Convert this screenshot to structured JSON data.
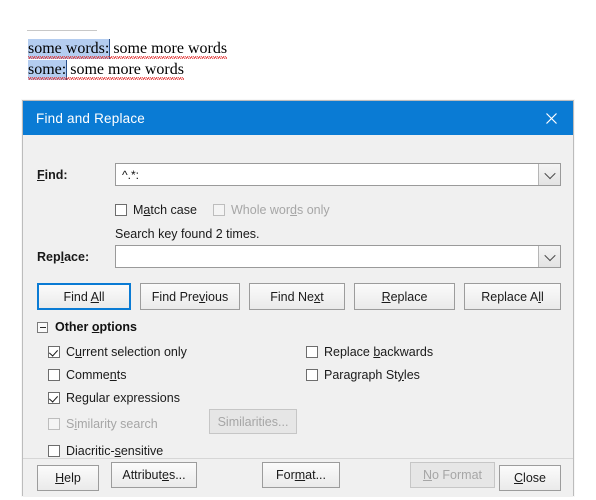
{
  "document": {
    "lines": [
      {
        "selected_text": "some words:",
        "rest_text": " some more words"
      },
      {
        "selected_text": "some:",
        "rest_text": " some more words"
      }
    ]
  },
  "dialog": {
    "title": "Find and Replace",
    "close_icon": "close-icon",
    "find": {
      "label": "Find:",
      "value": "^.*:",
      "placeholder": "",
      "dropdown_icon": "chevron-down-icon"
    },
    "replace": {
      "label": "Replace:",
      "value": "",
      "placeholder": "",
      "dropdown_icon": "chevron-down-icon"
    },
    "find_options": [
      {
        "label": "Match case",
        "mnemonic": "a",
        "checked": false,
        "disabled": false
      },
      {
        "label": "Whole words only",
        "mnemonic": "d",
        "checked": false,
        "disabled": true
      }
    ],
    "status": "Search key found 2 times.",
    "action_buttons": [
      {
        "label": "Find All",
        "mnemonic": "A",
        "focused": true,
        "disabled": false
      },
      {
        "label": "Find Previous",
        "mnemonic": "v",
        "focused": false,
        "disabled": false
      },
      {
        "label": "Find Next",
        "mnemonic": "x",
        "focused": false,
        "disabled": false
      },
      {
        "label": "Replace",
        "mnemonic": "R",
        "focused": false,
        "disabled": false
      },
      {
        "label": "Replace All",
        "mnemonic": "l",
        "focused": false,
        "disabled": false
      }
    ],
    "other_options": {
      "label": "Other options",
      "mnemonic": "o",
      "expanded": true,
      "left_column": [
        {
          "label": "Current selection only",
          "mnemonic": "u",
          "checked": true,
          "disabled": false
        },
        {
          "label": "Comments",
          "mnemonic": "n",
          "checked": false,
          "disabled": false
        },
        {
          "label": "Regular expressions",
          "mnemonic": "g",
          "checked": true,
          "disabled": false
        }
      ],
      "right_column": [
        {
          "label": "Replace backwards",
          "mnemonic": "b",
          "checked": false,
          "disabled": false
        },
        {
          "label": "Paragraph Styles",
          "mnemonic": "y",
          "checked": false,
          "disabled": false
        }
      ],
      "similarity": {
        "checkbox": {
          "label": "Similarity search",
          "mnemonic": "i",
          "checked": false,
          "disabled": true
        },
        "button": {
          "label": "Similarities...",
          "disabled": true
        }
      },
      "diacritic": {
        "label": "Diacritic-sensitive",
        "mnemonic": "s",
        "checked": false,
        "disabled": false
      },
      "format_buttons": [
        {
          "label": "Attributes...",
          "mnemonic": "e",
          "disabled": false
        },
        {
          "label": "Format...",
          "mnemonic": "m",
          "disabled": false
        },
        {
          "label": "No Format",
          "mnemonic": "N",
          "disabled": true
        }
      ]
    },
    "footer_buttons": [
      {
        "label": "Help",
        "mnemonic": "H",
        "disabled": false
      },
      {
        "label": "Close",
        "mnemonic": "C",
        "disabled": false
      }
    ]
  }
}
